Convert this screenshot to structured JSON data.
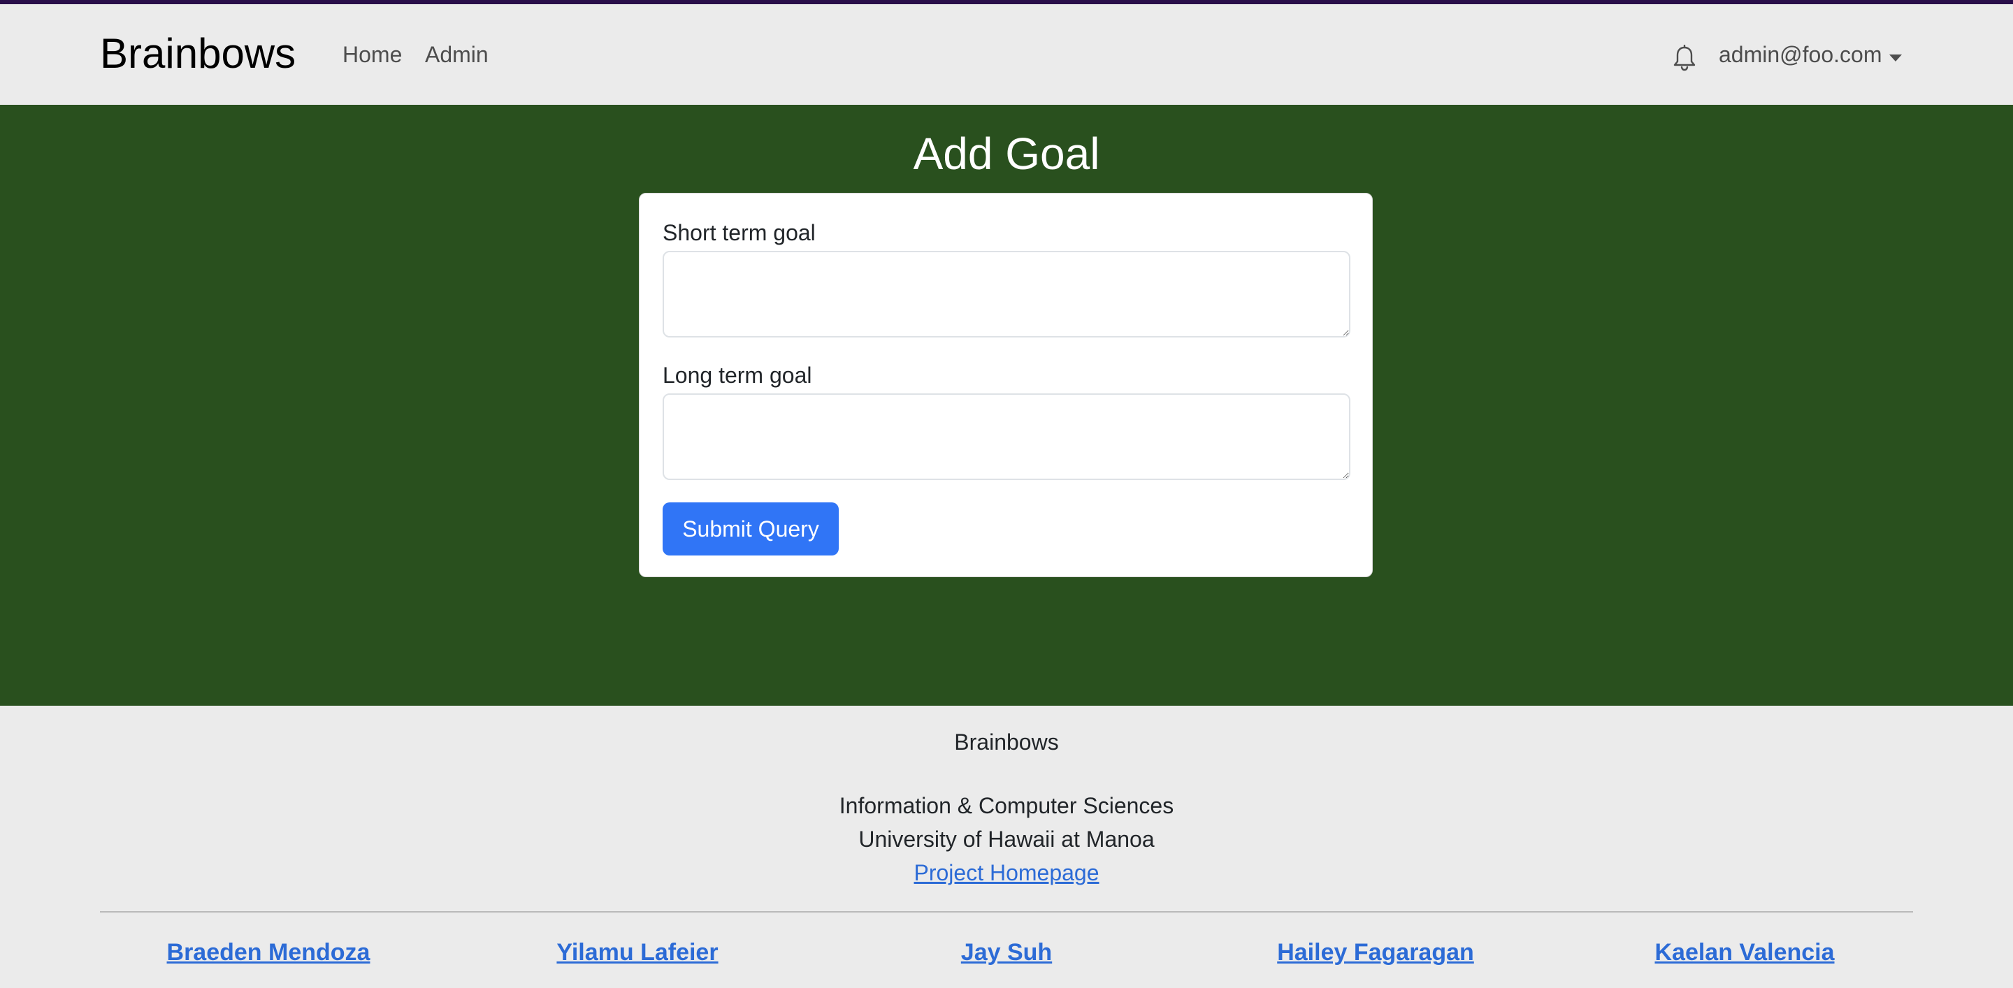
{
  "colors": {
    "main_background": "#29501e",
    "navbar_background": "#ebebeb",
    "primary_button": "#3075f6",
    "link": "#2c6bd6"
  },
  "navbar": {
    "brand": "Brainbows",
    "links": [
      {
        "label": "Home"
      },
      {
        "label": "Admin"
      }
    ],
    "notification_icon": "bell-icon",
    "user_menu": {
      "label": "admin@foo.com",
      "icon": "caret-down-icon"
    }
  },
  "main": {
    "title": "Add Goal",
    "form": {
      "short_term": {
        "label": "Short term goal",
        "value": "",
        "placeholder": ""
      },
      "long_term": {
        "label": "Long term goal",
        "value": "",
        "placeholder": ""
      },
      "submit_label": "Submit Query"
    }
  },
  "footer": {
    "brand": "Brainbows",
    "department": "Information & Computer Sciences",
    "university": "University of Hawaii at Manoa",
    "homepage_link": "Project Homepage",
    "members": [
      "Braeden Mendoza",
      "Yilamu Lafeier",
      "Jay Suh",
      "Hailey Fagaragan",
      "Kaelan Valencia"
    ]
  }
}
